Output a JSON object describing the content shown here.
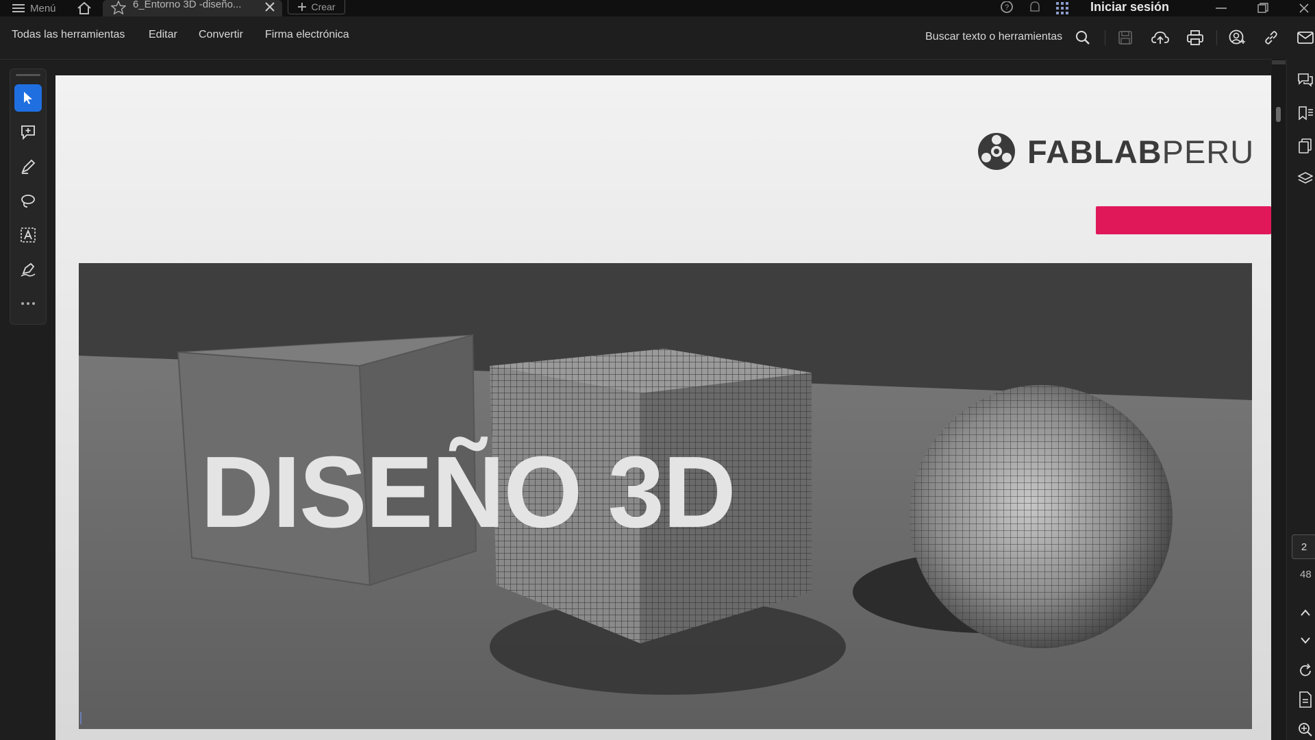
{
  "titlebar": {
    "menu_label": "Menú",
    "tab_title": "6_Entorno 3D -diseño...",
    "new_tab_label": "Crear",
    "signin_label": "Iniciar sesión"
  },
  "toolbar": {
    "items": [
      "Todas las herramientas",
      "Editar",
      "Convertir",
      "Firma electrónica"
    ],
    "search_label": "Buscar texto o herramientas"
  },
  "document": {
    "logo_bold": "FABLAB",
    "logo_light": "PERU",
    "hero_title": "DISEÑO 3D",
    "accent_color": "#e0185a"
  },
  "navigation": {
    "current_page": "2",
    "total_pages": "48"
  },
  "colors": {
    "active_tool": "#1f6fe0",
    "background": "#1e1e1e"
  }
}
